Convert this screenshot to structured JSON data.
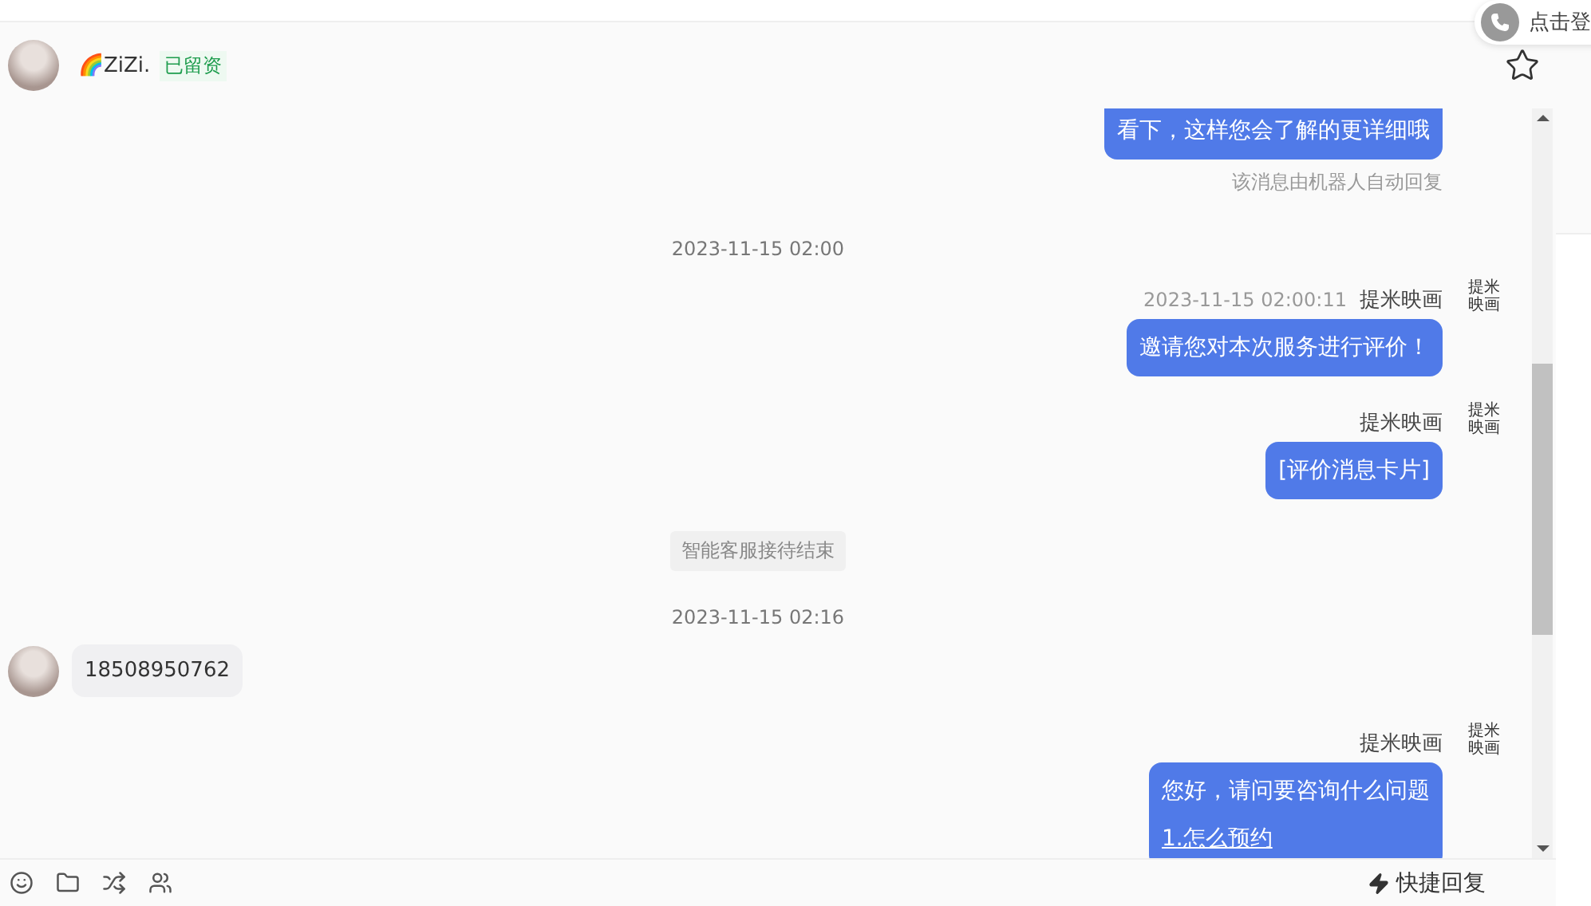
{
  "call_button": {
    "label": "点击登"
  },
  "contact": {
    "name": "🌈ZiZi.",
    "tag": "已留资",
    "starred": false
  },
  "messages": [
    {
      "kind": "agent",
      "text": "看下，这样您会了解的更详细哦"
    },
    {
      "kind": "note",
      "text": "该消息由机器人自动回复"
    },
    {
      "kind": "time",
      "text": "2023-11-15 02:00"
    },
    {
      "kind": "agent",
      "sender": "提米映画",
      "time": "2023-11-15 02:00:11",
      "logo": "提米映画",
      "text": "邀请您对本次服务进行评价！"
    },
    {
      "kind": "agent",
      "sender": "提米映画",
      "logo": "提米映画",
      "text": "[评价消息卡片]"
    },
    {
      "kind": "system",
      "text": "智能客服接待结束"
    },
    {
      "kind": "time",
      "text": "2023-11-15 02:16"
    },
    {
      "kind": "customer",
      "text": "18508950762"
    },
    {
      "kind": "agent",
      "sender": "提米映画",
      "logo": "提米映画",
      "text": "您好，请问要咨询什么问题",
      "link": "1.怎么预约"
    }
  ],
  "quick_reply": {
    "label": "快捷回复"
  }
}
